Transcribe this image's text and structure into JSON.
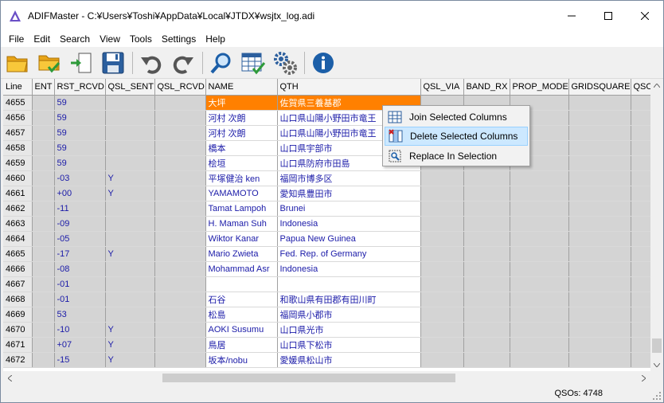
{
  "window": {
    "title": "ADIFMaster - C:¥Users¥Toshi¥AppData¥Local¥JTDX¥wsjtx_log.adi"
  },
  "menu": [
    "File",
    "Edit",
    "Search",
    "View",
    "Tools",
    "Settings",
    "Help"
  ],
  "toolbar": {
    "icons": [
      "open-folder-icon",
      "open-folder-check-icon",
      "import-file-icon",
      "save-icon",
      "undo-icon",
      "redo-icon",
      "search-icon",
      "grid-check-icon",
      "settings-gears-icon",
      "info-icon"
    ]
  },
  "grid": {
    "columns": [
      "Line",
      "ENT",
      "RST_RCVD",
      "QSL_SENT",
      "QSL_RCVD",
      "NAME",
      "QTH",
      "QSL_VIA",
      "BAND_RX",
      "PROP_MODE",
      "GRIDSQUARE",
      "QSO"
    ],
    "rows": [
      {
        "line": "4655",
        "rst": "59",
        "qsl_sent": "",
        "name": "大坪",
        "qth": "佐賀県三養基郡",
        "selected": true
      },
      {
        "line": "4656",
        "rst": "59",
        "qsl_sent": "",
        "name": "河村 次朗",
        "qth": "山口県山陽小野田市竜王",
        "selected": false
      },
      {
        "line": "4657",
        "rst": "59",
        "qsl_sent": "",
        "name": "河村 次朗",
        "qth": "山口県山陽小野田市竜王",
        "selected": false
      },
      {
        "line": "4658",
        "rst": "59",
        "qsl_sent": "",
        "name": "橋本",
        "qth": "山口県宇部市",
        "selected": false
      },
      {
        "line": "4659",
        "rst": "59",
        "qsl_sent": "",
        "name": "桧垣",
        "qth": "山口県防府市田島",
        "selected": false
      },
      {
        "line": "4660",
        "rst": "-03",
        "qsl_sent": "Y",
        "name": "平塚健治 ken",
        "qth": "福岡市博多区",
        "selected": false
      },
      {
        "line": "4661",
        "rst": "+00",
        "qsl_sent": "Y",
        "name": "YAMAMOTO",
        "qth": "愛知県豊田市",
        "selected": false
      },
      {
        "line": "4662",
        "rst": "-11",
        "qsl_sent": "",
        "name": "Tamat Lampoh",
        "qth": "Brunei",
        "selected": false
      },
      {
        "line": "4663",
        "rst": "-09",
        "qsl_sent": "",
        "name": "H. Maman Suh",
        "qth": "Indonesia",
        "selected": false
      },
      {
        "line": "4664",
        "rst": "-05",
        "qsl_sent": "",
        "name": "Wiktor Kanar",
        "qth": "Papua New Guinea",
        "selected": false
      },
      {
        "line": "4665",
        "rst": "-17",
        "qsl_sent": "Y",
        "name": "Mario Zwieta",
        "qth": "Fed. Rep. of Germany",
        "selected": false
      },
      {
        "line": "4666",
        "rst": "-08",
        "qsl_sent": "",
        "name": "Mohammad Asr",
        "qth": "Indonesia",
        "selected": false
      },
      {
        "line": "4667",
        "rst": "-01",
        "qsl_sent": "",
        "name": "",
        "qth": "",
        "selected": false
      },
      {
        "line": "4668",
        "rst": "-01",
        "qsl_sent": "",
        "name": "石谷",
        "qth": "和歌山県有田郡有田川町",
        "selected": false
      },
      {
        "line": "4669",
        "rst": "53",
        "qsl_sent": "",
        "name": "松島",
        "qth": "福岡県小郡市",
        "selected": false
      },
      {
        "line": "4670",
        "rst": "-10",
        "qsl_sent": "Y",
        "name": "AOKI Susumu",
        "qth": "山口県光市",
        "selected": false
      },
      {
        "line": "4671",
        "rst": "+07",
        "qsl_sent": "Y",
        "name": "鳥居",
        "qth": "山口県下松市",
        "selected": false
      },
      {
        "line": "4672",
        "rst": "-15",
        "qsl_sent": "Y",
        "name": "坂本/nobu",
        "qth": "愛媛県松山市",
        "selected": false
      }
    ]
  },
  "context_menu": {
    "items": [
      {
        "label": "Join Selected Columns",
        "icon": "join-columns-icon",
        "highlighted": false
      },
      {
        "label": "Delete Selected Columns",
        "icon": "delete-columns-icon",
        "highlighted": true
      },
      {
        "label": "Replace In Selection",
        "icon": "replace-selection-icon",
        "highlighted": false
      }
    ]
  },
  "status": {
    "qsos": "QSOs: 4748"
  },
  "colors": {
    "selection": "#ff8000",
    "cell_text": "#1a1aa8",
    "menu_highlight": "#cce8ff"
  }
}
